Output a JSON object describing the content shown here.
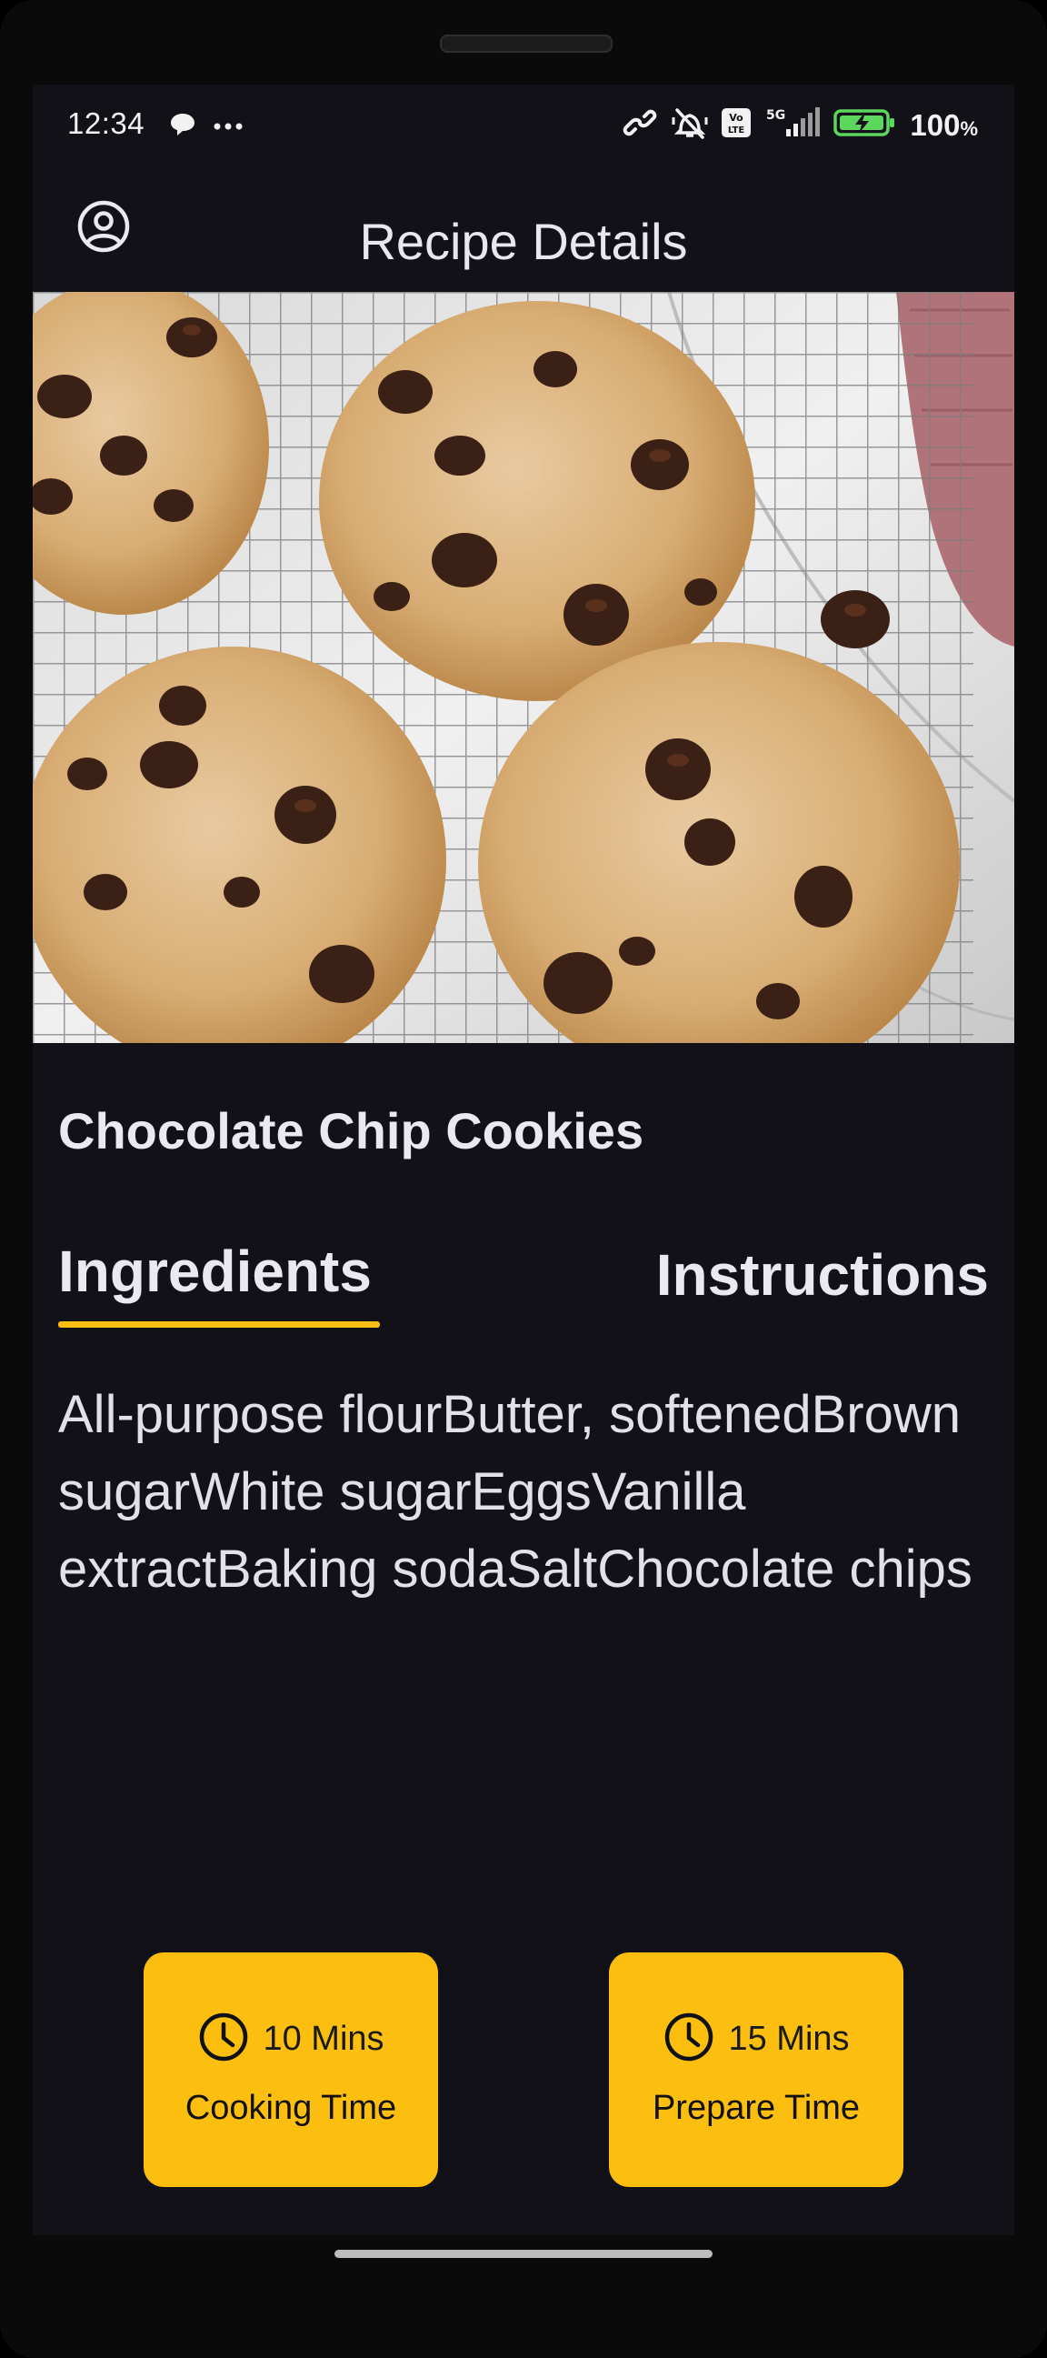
{
  "status_bar": {
    "time": "12:34",
    "left_icons": [
      "chat-bubble-icon",
      "more-dots-icon"
    ],
    "right_icons": [
      "link-icon",
      "vibrate-muted-icon",
      "volte-icon",
      "signal-5g-icon",
      "battery-charging-icon"
    ],
    "network": "5G",
    "volte": "Vo LTE",
    "battery_percent": "100",
    "battery_unit": "%"
  },
  "app_bar": {
    "title": "Recipe Details",
    "profile_icon": "account-circle-icon"
  },
  "recipe": {
    "title": "Chocolate Chip Cookies",
    "tabs": [
      {
        "label": "Ingredients",
        "selected": true
      },
      {
        "label": "Instructions",
        "selected": false
      }
    ],
    "ingredients_text": "All-purpose flourButter, softenedBrown sugarWhite sugarEggsVanilla extractBaking sodaSaltChocolate chips"
  },
  "time_cards": [
    {
      "value": "10 Mins",
      "label": "Cooking Time",
      "icon": "clock-icon"
    },
    {
      "value": "15 Mins",
      "label": "Prepare Time",
      "icon": "clock-icon"
    }
  ],
  "colors": {
    "background": "#131118",
    "accent": "#fcbf0f",
    "text": "#ece8f0"
  }
}
